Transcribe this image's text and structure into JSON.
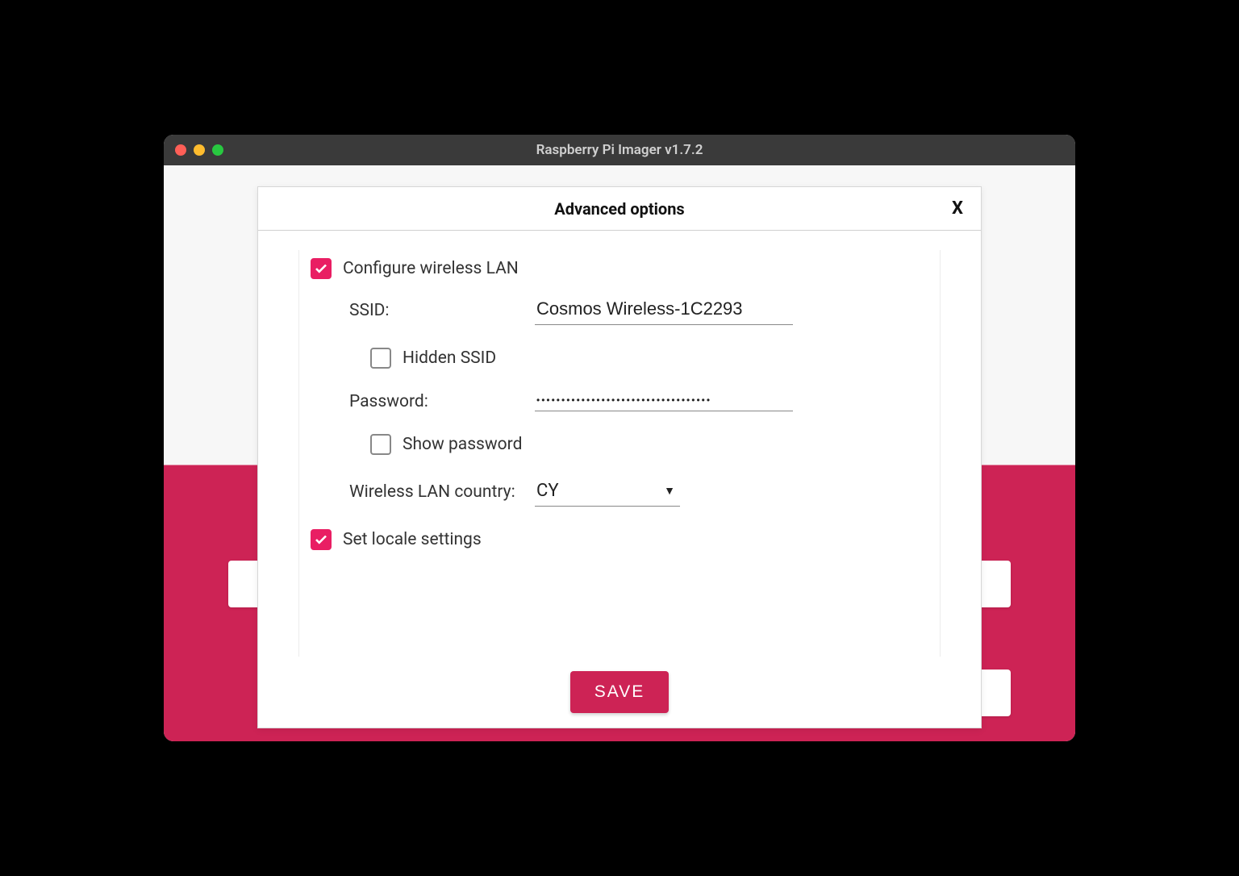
{
  "window": {
    "title": "Raspberry Pi Imager v1.7.2"
  },
  "dialog": {
    "title": "Advanced options",
    "close": "X",
    "save_button": "SAVE"
  },
  "form": {
    "configure_wlan": {
      "label": "Configure wireless LAN",
      "checked": true
    },
    "ssid": {
      "label": "SSID:",
      "value": "Cosmos Wireless-1C2293"
    },
    "hidden_ssid": {
      "label": "Hidden SSID",
      "checked": false
    },
    "password": {
      "label": "Password:",
      "value": "•••••••••••••••••••••••••••••••••••"
    },
    "show_password": {
      "label": "Show password",
      "checked": false
    },
    "wlan_country": {
      "label": "Wireless LAN country:",
      "value": "CY"
    },
    "set_locale": {
      "label": "Set locale settings",
      "checked": true
    }
  },
  "colors": {
    "accent": "#cd2355",
    "checkbox": "#e91e63"
  }
}
